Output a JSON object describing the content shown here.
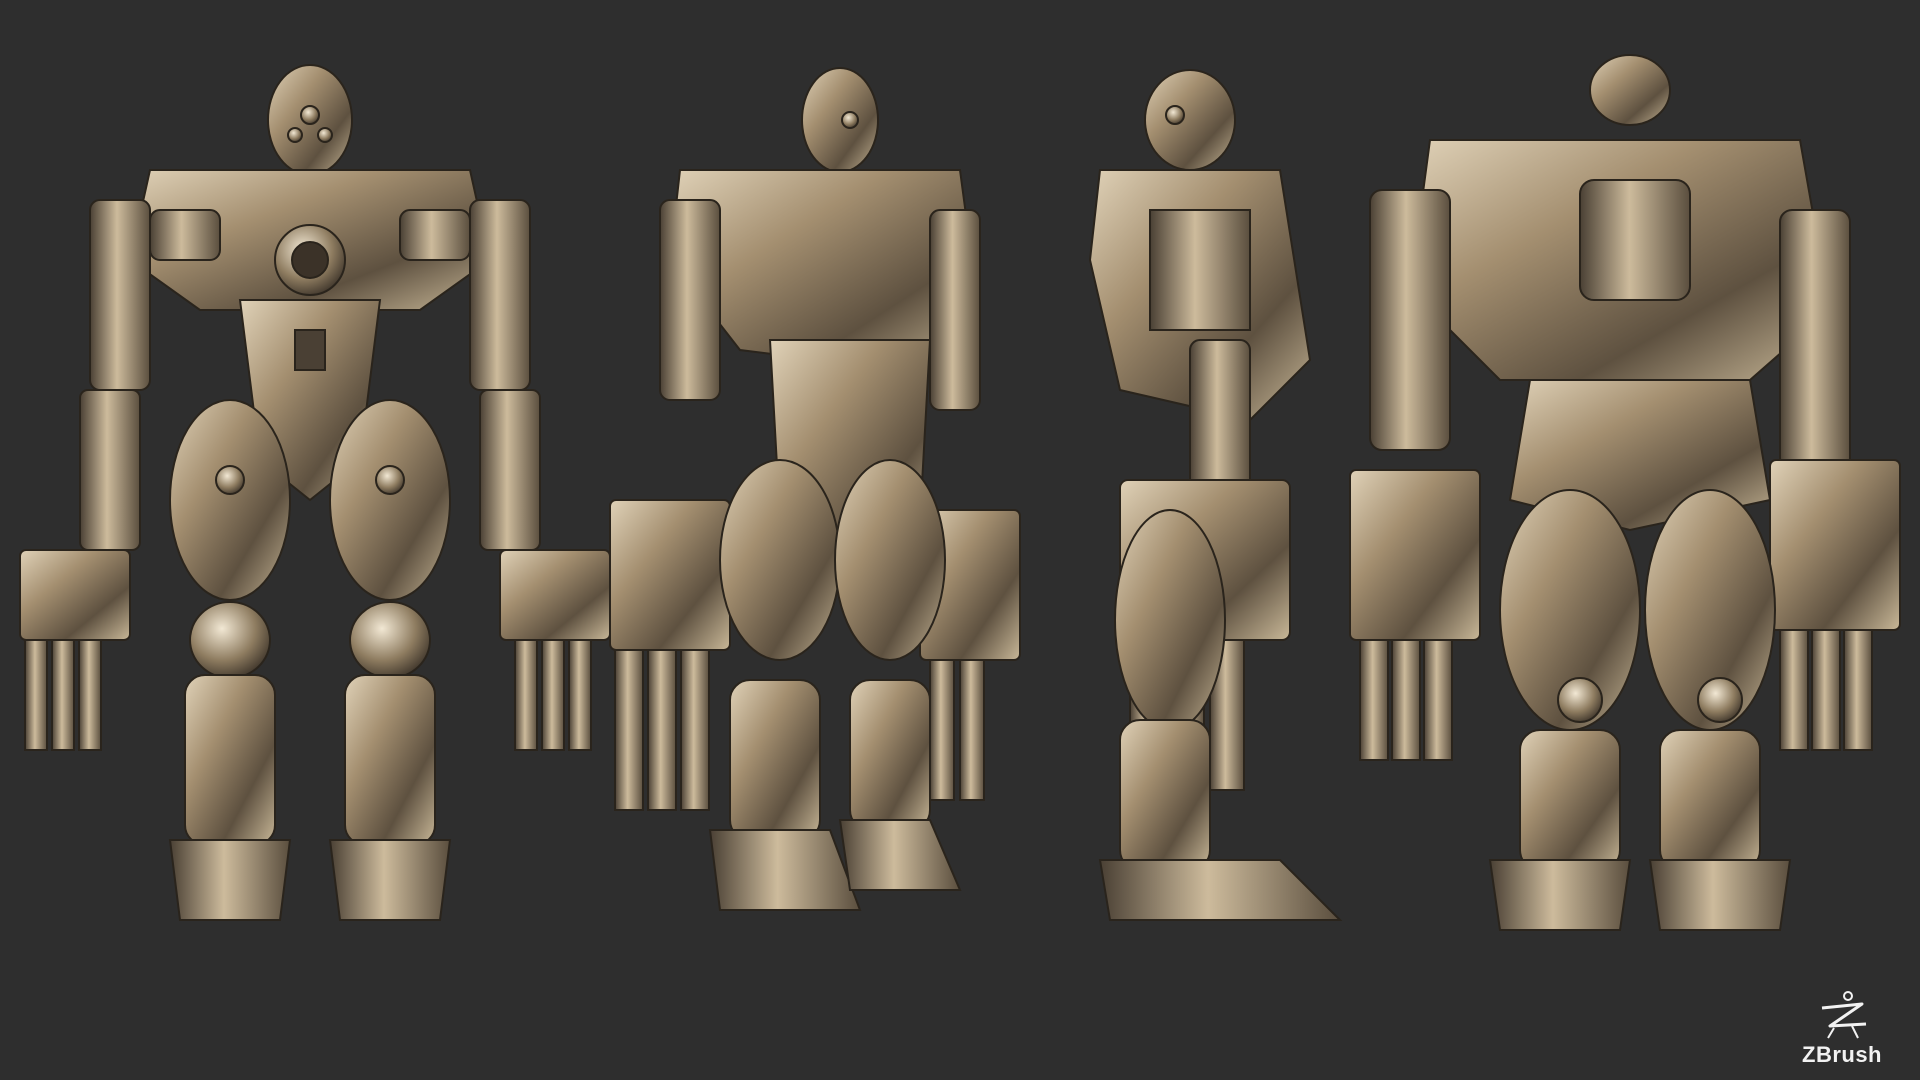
{
  "scene": {
    "subject": "robot",
    "views": [
      "front",
      "front-three-quarter",
      "side",
      "back-three-quarter"
    ],
    "background_color": "#2e2e2e",
    "metal_color": "#a48f70"
  },
  "logo": {
    "text": "ZBrush"
  }
}
